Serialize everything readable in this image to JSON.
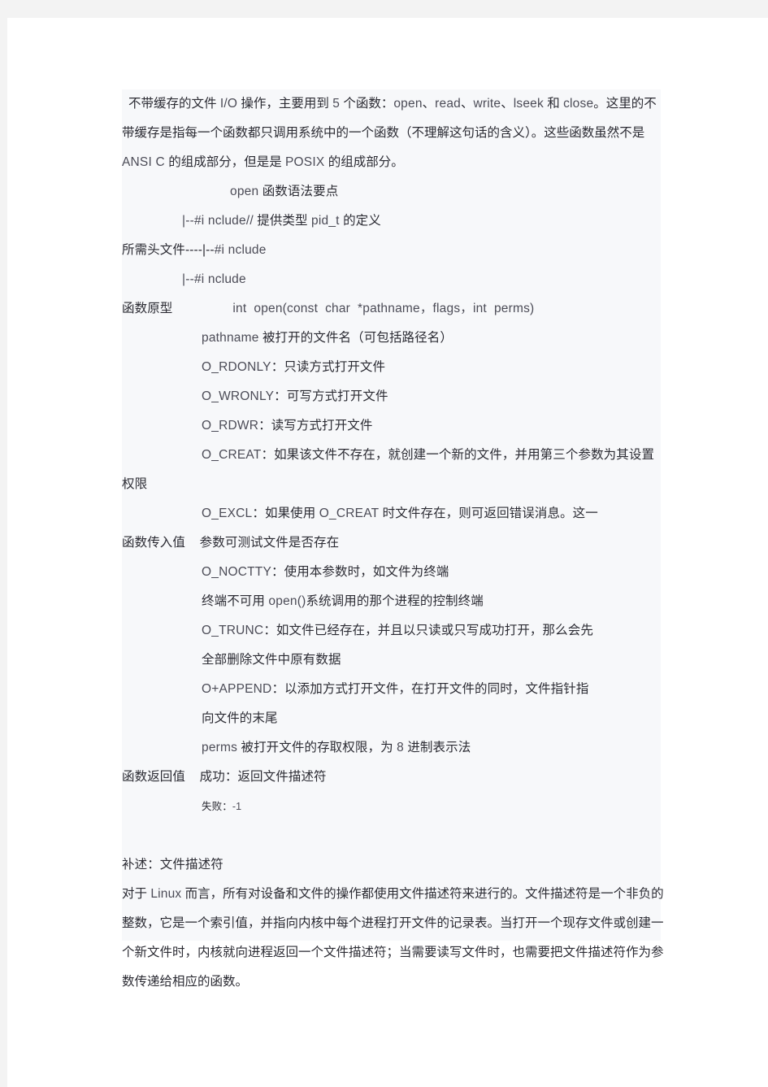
{
  "document": {
    "page_background": "#ffffff",
    "outer_background": "#f3f3f3",
    "text_block_background": "#f7f8fa",
    "text_color": "#2b2b33",
    "latin_text_color": "#4c4c57",
    "intro": {
      "p1_a": " 不带缓存的文件 ",
      "p1_io": "I/O",
      "p1_b": " 操作，主要用到 ",
      "p1_five": "5",
      "p1_c": " 个函数：",
      "p1_open": "open",
      "p1_d": "、",
      "p1_read": "read",
      "p1_e": "、",
      "p1_write": "write",
      "p1_f": "、",
      "p1_lseek": "lseek",
      "p1_g": " 和 ",
      "p1_close": "close",
      "p1_h": "。这里的不带缓存是指每一个函数都只调用系统中的一个函数（不理解这句话的含义）。这些函数虽然不是 ",
      "p1_ansi": "ANSI",
      "p1_i": "  C",
      "p1_j": " 的组成部分，但是是 ",
      "p1_posix": "POSIX",
      "p1_k": "  的组成部分。"
    },
    "title_line": {
      "open": "open",
      "rest": " 函数语法要点"
    },
    "headers": [
      {
        "prefix": "|--",
        "include": "#i nclude",
        "comment_slashes": "//",
        "comment_text": " 提供类型 ",
        "pid": "pid_t",
        "comment_tail": " 的定义"
      },
      {
        "label": "所需头文件----|--",
        "include": "#i nclude"
      },
      {
        "prefix": "|--",
        "include": "#i nclude"
      }
    ],
    "prototype": {
      "label": "函数原型",
      "code": "int  open(const  char  *pathname，flags，int  perms)"
    },
    "params": {
      "pathname_name": "pathname",
      "pathname_desc": " 被打开的文件名（可包括路径名）",
      "flags": [
        {
          "name": "O_RDONLY",
          "desc": "：只读方式打开文件"
        },
        {
          "name": "O_WRONLY",
          "desc": "：可写方式打开文件"
        },
        {
          "name": "O_RDWR",
          "desc": "：读写方式打开文件"
        }
      ],
      "creat_name": "O_CREAT",
      "creat_desc": "：如果该文件不存在，就创建一个新的文件，并用第三个参数为其设置",
      "creat_cont": "权限",
      "excl_name": "O_EXCL",
      "excl_desc_a": "：如果使用 ",
      "excl_creat": "O_CREAT",
      "excl_desc_b": " 时文件存在，则可返回错误消息。这一",
      "inval_label": "函数传入值",
      "inval_cont": "    参数可测试文件是否存在",
      "noctty_name": "O_NOCTTY",
      "noctty_desc": "：使用本参数时，如文件为终端",
      "noctty_cont_a": "终端不可用 ",
      "noctty_cont_open": "open()",
      "noctty_cont_b": "系统调用的那个进程的控制终端",
      "trunc_name": "O_TRUNC",
      "trunc_desc": "：如文件已经存在，并且以只读或只写成功打开，那么会先",
      "trunc_cont": "全部删除文件中原有数据",
      "append_name": "O+APPEND",
      "append_desc": "：以添加方式打开文件，在打开文件的同时，文件指针指",
      "append_cont": "向文件的末尾",
      "perms_name": "perms",
      "perms_desc_a": " 被打开文件的存取权限，为 ",
      "perms_eight": "8",
      "perms_desc_b": " 进制表示法"
    },
    "retval": {
      "label": "函数返回值",
      "success": "    成功：返回文件描述符",
      "fail_label": "失败：",
      "fail_value": "-1"
    },
    "supplement": {
      "heading": "补述：文件描述符",
      "body_a": "    对于 ",
      "body_linux": "Linux",
      "body_b": "  而言，所有对设备和文件的操作都使用文件描述符来进行的。文件描述符是一个非负的整数，它是一个索引值，并指向内核中每个进程打开文件的记录表。当打开一个现存文件或创建一个新文件时，内核就向进程返回一个文件描述符；当需要读写文件时，也需要把文件描述符作为参数传递给相应的函数。"
    }
  }
}
